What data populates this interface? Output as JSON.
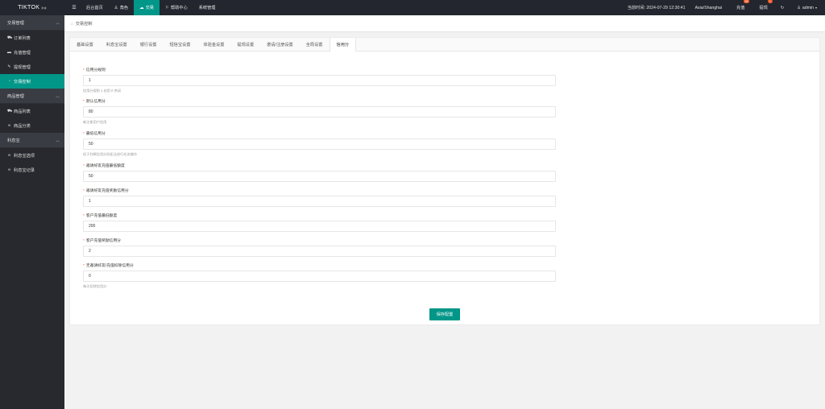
{
  "brand": {
    "name": "TIKTOK",
    "sup": "商城"
  },
  "topnav": {
    "items": [
      {
        "label": "后台首页",
        "icon": ""
      },
      {
        "label": "角色",
        "icon": "user-icon"
      },
      {
        "label": "交易",
        "icon": "cloud-icon"
      },
      {
        "label": "帮助中心",
        "icon": "flag-icon"
      },
      {
        "label": "系统管理",
        "icon": ""
      }
    ],
    "time_label": "当前时间: 2024-07-29 12:30:41",
    "timezone": "Asia/Shanghai",
    "recharge_label": "充值",
    "recharge_badge": "99",
    "withdraw_label": "提现",
    "withdraw_badge": "1",
    "user": "admin"
  },
  "sidebar": {
    "groups": [
      {
        "label": "交易管理",
        "items": [
          "订单列表",
          "充值管理",
          "提现管理",
          "交易控制"
        ]
      },
      {
        "label": "商品管理",
        "items": [
          "商品列表",
          "商品分类"
        ]
      },
      {
        "label": "利息宝",
        "items": [
          "利息宝选项",
          "利息宝记录"
        ]
      }
    ]
  },
  "breadcrumb": "交易控制",
  "tabs": [
    "基础设置",
    "利息宝设置",
    "银行设置",
    "短信宝设置",
    "体验金设置",
    "提现设置",
    "邀请/注册设置",
    "全局设置",
    "信用分"
  ],
  "form": {
    "fields": [
      {
        "label": "信用分规则",
        "value": "1",
        "hint": "信用分规则 1 启用 0 关闭"
      },
      {
        "label": "默认信用分",
        "value": "80",
        "hint": "新注册用户信用"
      },
      {
        "label": "最低信用分",
        "value": "50",
        "hint": "低于判断信用分则无法进行任务操作"
      },
      {
        "label": "邀请好友充值最低额度",
        "value": "50",
        "hint": ""
      },
      {
        "label": "邀请好友充值奖励信用分",
        "value": "1",
        "hint": ""
      },
      {
        "label": "客户充值最低额度",
        "value": "200",
        "hint": ""
      },
      {
        "label": "客户充值奖励信用分",
        "value": "2",
        "hint": ""
      },
      {
        "label": "无邀请好友/充值扣除信用分",
        "value": "0",
        "hint": "每天扣除信用分"
      }
    ],
    "save_label": "保存配置"
  },
  "colors": {
    "accent": "#009688",
    "topbar": "#23262e",
    "sidebar": "#28292e",
    "badge": "#ff5722"
  }
}
